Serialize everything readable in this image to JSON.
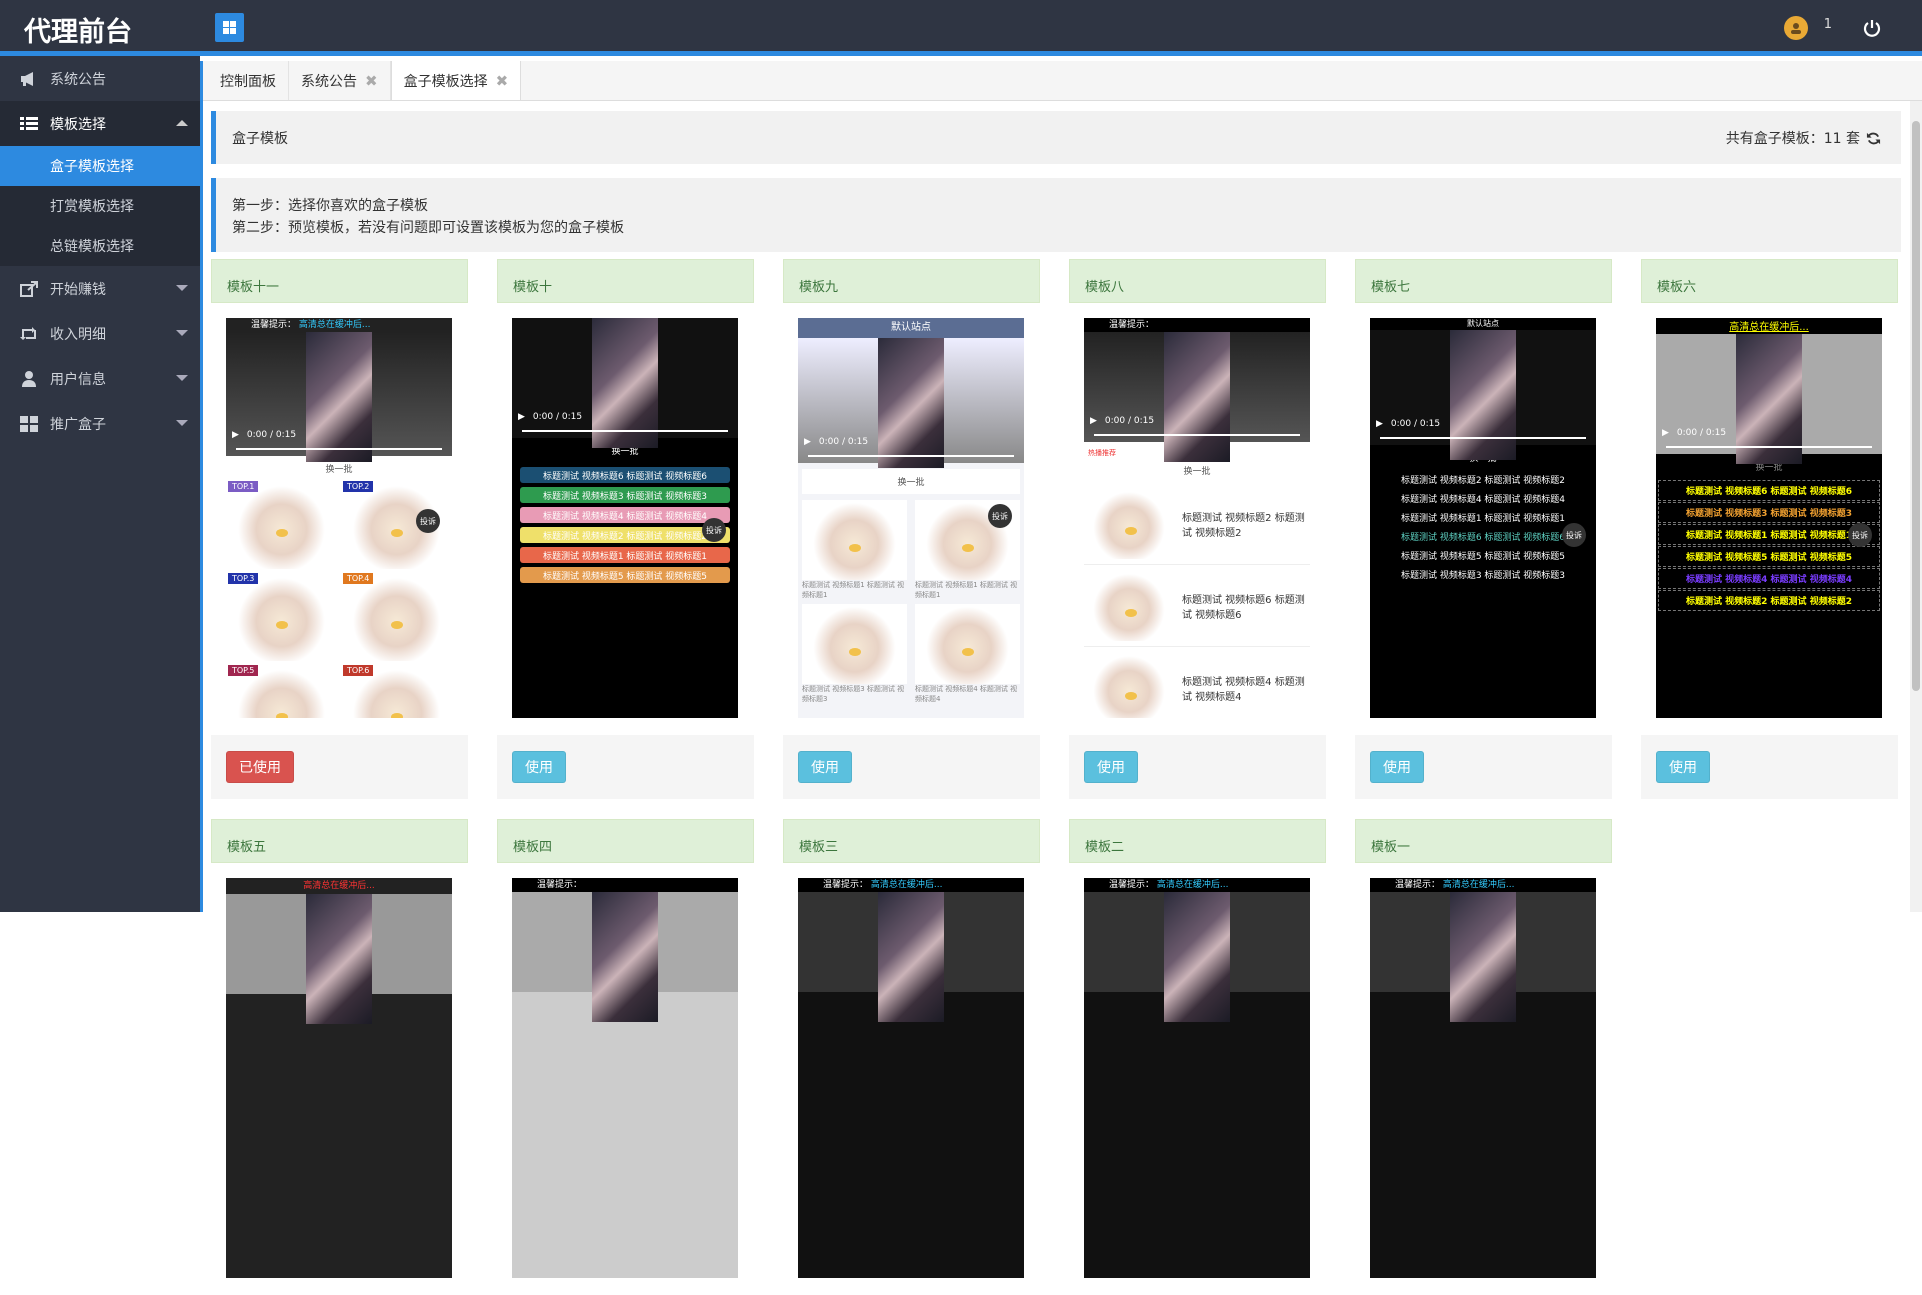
{
  "app": {
    "brand": "代理前台",
    "notif_count": "1"
  },
  "sidebar": {
    "items": [
      {
        "label": "系统公告",
        "icon": "bullhorn-icon"
      },
      {
        "label": "模板选择",
        "icon": "list-icon",
        "open": true,
        "subs": [
          "盒子模板选择",
          "打赏模板选择",
          "总链模板选择"
        ]
      },
      {
        "label": "开始赚钱",
        "icon": "share-icon"
      },
      {
        "label": "收入明细",
        "icon": "retweet-icon"
      },
      {
        "label": "用户信息",
        "icon": "user-icon"
      },
      {
        "label": "推广盒子",
        "icon": "grid-icon"
      }
    ]
  },
  "tabs": [
    {
      "label": "控制面板",
      "closable": false
    },
    {
      "label": "系统公告",
      "closable": true
    },
    {
      "label": "盒子模板选择",
      "closable": true,
      "active": true
    }
  ],
  "header": {
    "title": "盒子模板",
    "count_label": "共有盒子模板：11 套"
  },
  "steps": {
    "step1": "第一步：选择你喜欢的盒子模板",
    "step2": "第二步：预览模板，若没有问题即可设置该模板为您的盒子模板"
  },
  "preview": {
    "tip": "温馨提示：",
    "buffering": "高清总在缓冲后...",
    "default_site": "默认站点",
    "refresh": "换一批",
    "report": "投诉",
    "time": "0:00 / 0:15",
    "top_labels": [
      "TOP.1",
      "TOP.2",
      "TOP.3",
      "TOP.4",
      "TOP.5",
      "TOP.6"
    ],
    "caption": "标题测试",
    "recommend": "热播推荐",
    "list_lines": [
      "标题测试 视频标题6 标题测试 视频标题6",
      "标题测试 视频标题3 标题测试 视频标题3",
      "标题测试 视频标题4 标题测试 视频标题4",
      "标题测试 视频标题2 标题测试 视频标题2",
      "标题测试 视频标题1 标题测试 视频标题1",
      "标题测试 视频标题5 标题测试 视频标题5"
    ],
    "t8_items": [
      "标题测试 视频标题2 标题测试 视频标题2",
      "标题测试 视频标题6 标题测试 视频标题6",
      "标题测试 视频标题4 标题测试 视频标题4"
    ],
    "t9_caps": [
      "标题测试 视频标题1 标题测试 视频标题1",
      "标题测试 视频标题1 标题测试 视频标题1",
      "标题测试 视频标题3 标题测试 视频标题3",
      "标题测试 视频标题4 标题测试 视频标题4"
    ]
  },
  "templates_row1": [
    {
      "name": "模板十一",
      "button": "已使用",
      "used": true
    },
    {
      "name": "模板十",
      "button": "使用",
      "used": false
    },
    {
      "name": "模板九",
      "button": "使用",
      "used": false
    },
    {
      "name": "模板八",
      "button": "使用",
      "used": false
    },
    {
      "name": "模板七",
      "button": "使用",
      "used": false
    },
    {
      "name": "模板六",
      "button": "使用",
      "used": false
    }
  ],
  "templates_row2": [
    "模板五",
    "模板四",
    "模板三",
    "模板二",
    "模板一"
  ],
  "colors": {
    "accent": "#2d8ae0",
    "dark": "#2f3543",
    "danger": "#d9534f",
    "info": "#5bc0de"
  }
}
